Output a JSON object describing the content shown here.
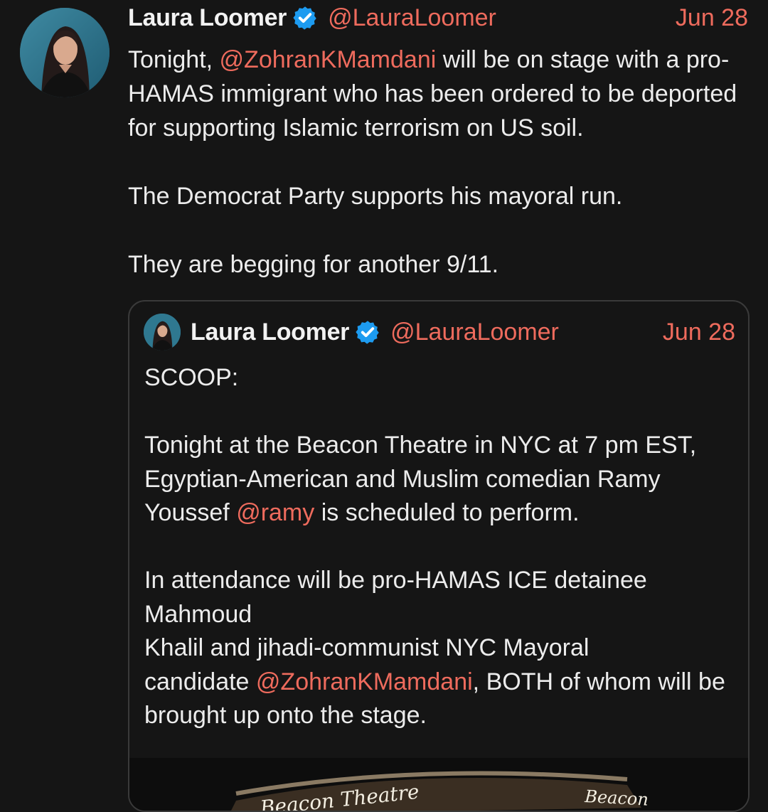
{
  "tweet": {
    "author_name": "Laura Loomer",
    "handle": "@LauraLoomer",
    "date": "Jun 28",
    "body": {
      "line1_before": "Tonight, ",
      "line1_mention": "@ZohranKMamdani",
      "line1_after": " will be on stage with a pro-HAMAS immigrant who has been ordered to be deported for supporting Islamic terrorism on US soil.",
      "para2": "The Democrat Party supports his mayoral run.",
      "para3": "They are begging for another 9/11."
    }
  },
  "quoted_tweet": {
    "author_name": "Laura Loomer",
    "handle": "@LauraLoomer",
    "date": "Jun 28",
    "body": {
      "para1": "SCOOP:",
      "para2_before": "Tonight at the Beacon Theatre in NYC at 7 pm EST, Egyptian-American and Muslim comedian Ramy Youssef ",
      "para2_mention": "@ramy",
      "para2_after": " is scheduled to perform.",
      "para3_line1": "In attendance will be pro-HAMAS ICE detainee",
      "para3_line2": "Mahmoud",
      "para3_line3": "Khalil and jihadi-communist NYC Mayoral",
      "para3_line4_before": "candidate ",
      "para3_line4_mention": "@ZohranKMamdani",
      "para3_line4_after": ", BOTH of whom will be brought up onto the stage."
    },
    "media": {
      "sign_left": "Beacon Theatre",
      "sign_right": "Beacon"
    }
  },
  "colors": {
    "background": "#151515",
    "text": "#ececec",
    "accent": "#ee6b5d",
    "verified": "#1d9bf0",
    "quote_border": "#3a3a3a"
  },
  "icons": {
    "verified": "verified-badge-icon"
  }
}
